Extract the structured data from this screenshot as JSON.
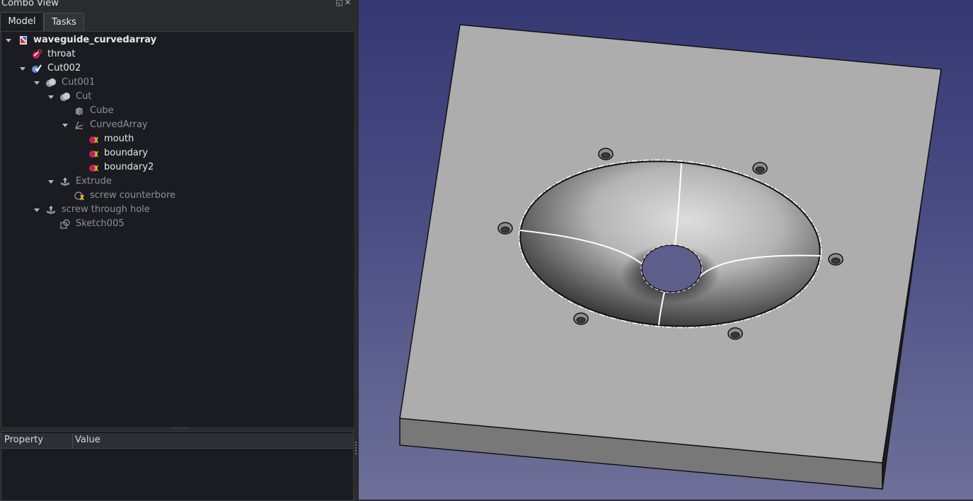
{
  "panel": {
    "title": "Combo View",
    "tabs": [
      {
        "label": "Model",
        "active": true
      },
      {
        "label": "Tasks",
        "active": false
      }
    ]
  },
  "tree": [
    {
      "label": "waveguide_curvedarray",
      "icon": "document-icon",
      "state": "bright",
      "bold": true,
      "expanded": true
    },
    {
      "label": "throat",
      "icon": "sketch-error-icon",
      "state": "bright"
    },
    {
      "label": "Cut002",
      "icon": "boolean-cut-check-icon",
      "state": "bright",
      "expanded": true
    },
    {
      "label": "Cut001",
      "icon": "boolean-cut-icon",
      "state": "dim",
      "expanded": true
    },
    {
      "label": "Cut",
      "icon": "boolean-cut-icon",
      "state": "dim",
      "expanded": true
    },
    {
      "label": "Cube",
      "icon": "cube-icon",
      "state": "dim"
    },
    {
      "label": "CurvedArray",
      "icon": "curved-array-icon",
      "state": "dim",
      "expanded": true
    },
    {
      "label": "mouth",
      "icon": "sketch-error-icon",
      "state": "bright"
    },
    {
      "label": "boundary",
      "icon": "sketch-error-icon",
      "state": "bright"
    },
    {
      "label": "boundary2",
      "icon": "sketch-error-icon",
      "state": "bright"
    },
    {
      "label": "Extrude",
      "icon": "extrude-icon",
      "state": "dim",
      "expanded": true
    },
    {
      "label": "screw counterbore",
      "icon": "sketch-warning-icon",
      "state": "dim"
    },
    {
      "label": "screw through hole",
      "icon": "extrude-icon",
      "state": "dim",
      "expanded": true
    },
    {
      "label": "Sketch005",
      "icon": "sketch-icon",
      "state": "dim"
    }
  ],
  "properties": {
    "col_property": "Property",
    "col_value": "Value"
  },
  "colors": {
    "viewport_top": "#353872",
    "viewport_bottom": "#6e7099",
    "tree_bg": "#1b1c21",
    "panel_bg": "#2a2b2e",
    "part_top": "#adadad",
    "part_side": "#787878"
  }
}
